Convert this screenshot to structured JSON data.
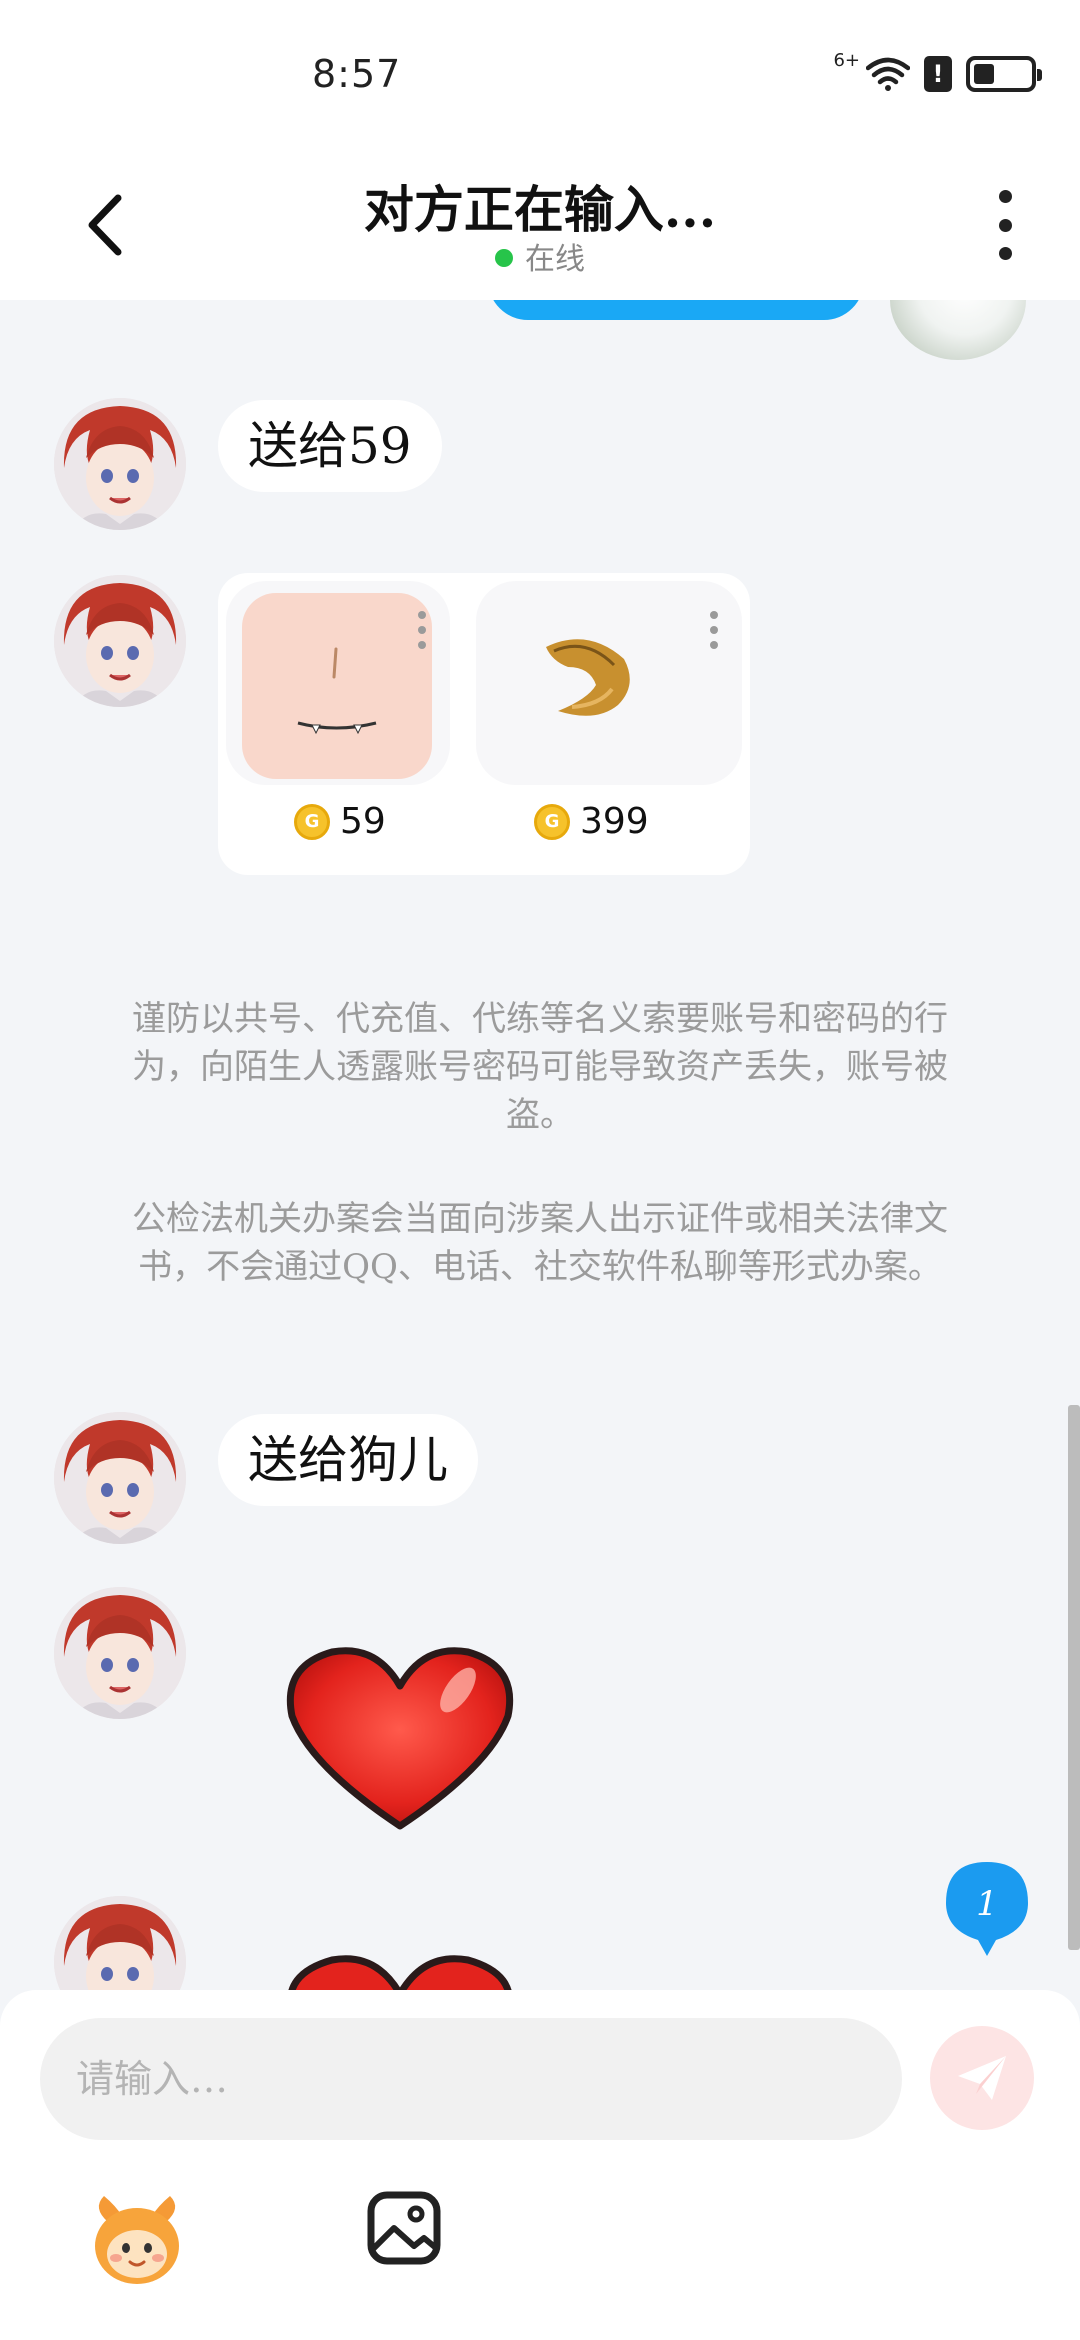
{
  "status_bar": {
    "time": "8:57",
    "signal_label": "6+"
  },
  "header": {
    "title": "对方正在输入...",
    "status": "在线",
    "status_color": "#27c44a"
  },
  "messages": [
    {
      "type": "text",
      "text": "送给59"
    },
    {
      "type": "gift_card",
      "items": [
        {
          "name": "face",
          "price": "59"
        },
        {
          "name": "tail",
          "price": "399"
        }
      ]
    },
    {
      "type": "notice",
      "text": "谨防以共号、代充值、代练等名义索要账号和密码的行为，向陌生人透露账号密码可能导致资产丢失，账号被盗。"
    },
    {
      "type": "notice",
      "text": "公检法机关办案会当面向涉案人出示证件或相关法律文书，不会通过QQ、电话、社交软件私聊等形式办案。"
    },
    {
      "type": "text",
      "text": "送给狗儿"
    },
    {
      "type": "sticker",
      "icon": "heart-sticker"
    }
  ],
  "unread_count": "1",
  "composer": {
    "placeholder": "请输入…",
    "send_icon": "paper-plane-icon"
  },
  "toolbar": {
    "items": [
      "mascot-emoji-icon",
      "image-icon"
    ]
  },
  "colors": {
    "accent_blue": "#1aa8f5",
    "coin": "#f6c22b",
    "send_disabled": "#fde4e4"
  }
}
